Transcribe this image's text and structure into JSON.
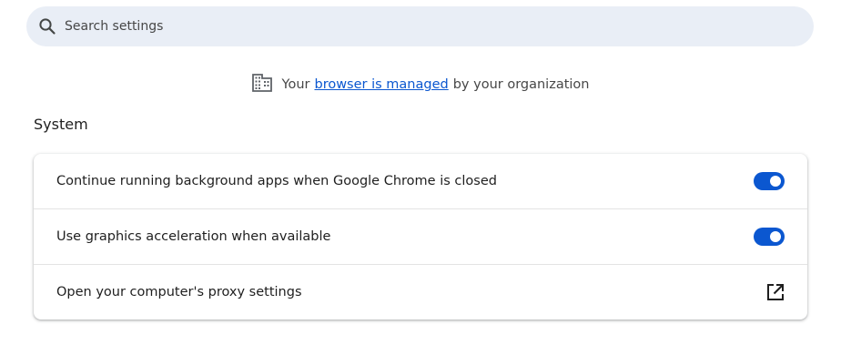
{
  "search": {
    "placeholder": "Search settings",
    "icon": "search-icon"
  },
  "managed_notice": {
    "prefix": "Your",
    "link": "browser is managed",
    "suffix": "by your organization",
    "icon": "building-icon"
  },
  "section": {
    "title": "System",
    "rows": [
      {
        "label": "Continue running background apps when Google Chrome is closed",
        "control": "toggle",
        "enabled": true
      },
      {
        "label": "Use graphics acceleration when available",
        "control": "toggle",
        "enabled": true
      },
      {
        "label": "Open your computer's proxy settings",
        "control": "external-link",
        "icon": "open-in-new-icon"
      }
    ]
  },
  "colors": {
    "accent": "#0b57d0",
    "search_bg": "#e9eef6",
    "text": "#1f1f1f",
    "secondary_text": "#474747"
  }
}
